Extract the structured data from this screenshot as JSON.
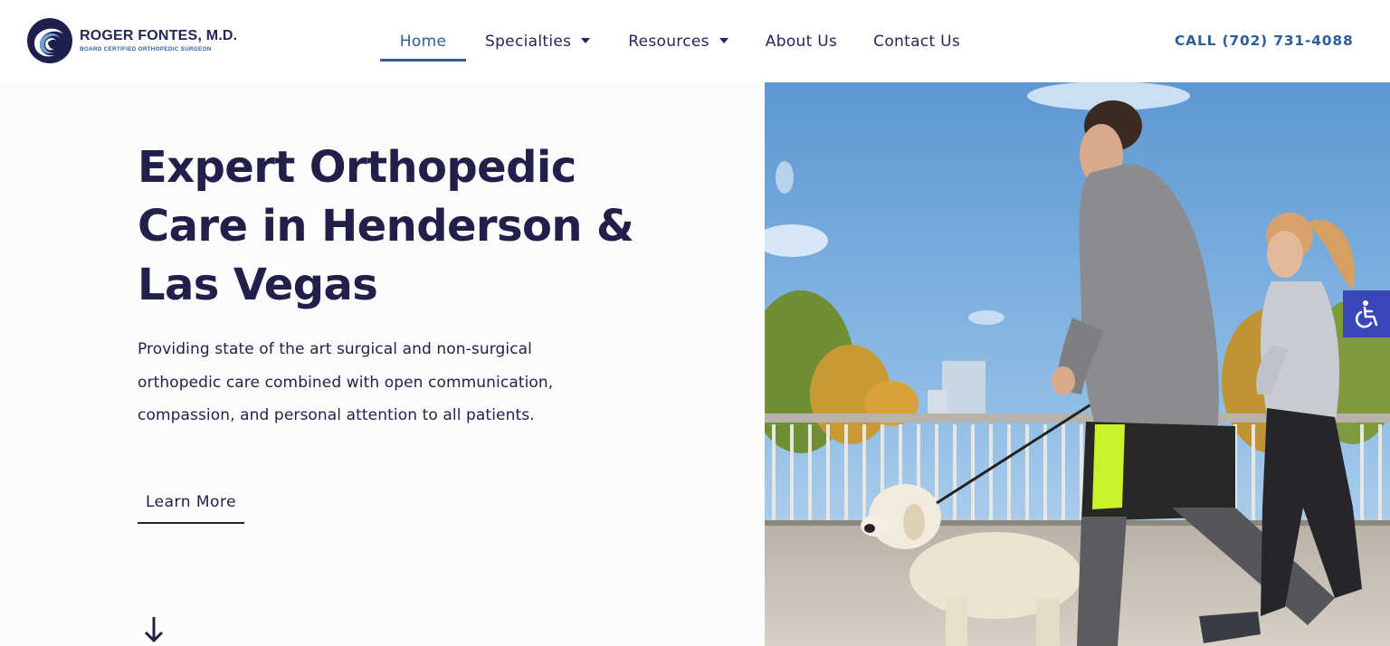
{
  "logo": {
    "name": "ROGER FONTES, M.D.",
    "subtitle": "BOARD CERTIFIED ORTHOPEDIC SURGEON",
    "icon": "swirl-logo-icon"
  },
  "nav": {
    "items": [
      {
        "label": "Home",
        "active": true
      },
      {
        "label": "Specialties",
        "dropdown": true
      },
      {
        "label": "Resources",
        "dropdown": true
      },
      {
        "label": "About Us"
      },
      {
        "label": "Contact Us"
      }
    ]
  },
  "call": "CALL (702) 731-4088",
  "hero": {
    "title": "Expert Orthopedic Care in Henderson & Las Vegas",
    "text": "Providing state of the art surgical and non-surgical orthopedic care combined with open communication, compassion, and personal attention to all patients.",
    "cta": "Learn More",
    "scroll_icon": "arrow-down-icon",
    "image_icon": "runners-with-dog-photo"
  },
  "accessibility": {
    "icon": "wheelchair-icon"
  },
  "colors": {
    "navy": "#20204a",
    "accent_blue": "#2e5e9a",
    "a11y_blue": "#3b47b8",
    "background": "#fcfcfd"
  }
}
